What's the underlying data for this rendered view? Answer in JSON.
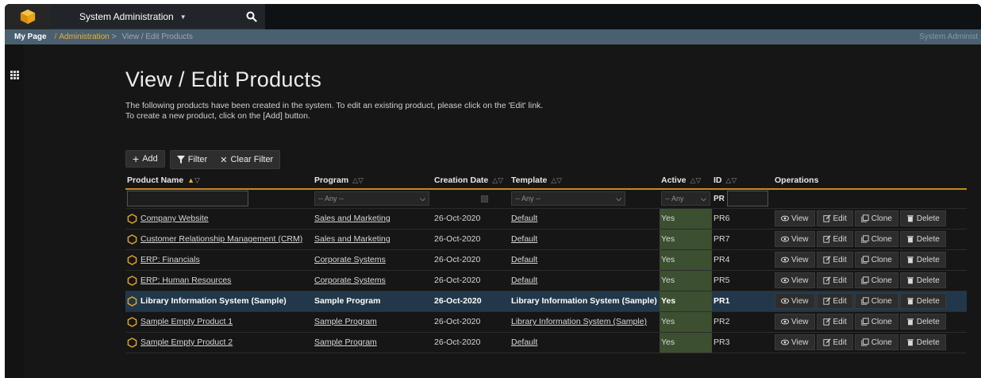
{
  "topbar": {
    "nav_title": "System Administration",
    "colors": {
      "logo": "#e8a317",
      "bar": "#212529"
    }
  },
  "breadcrumb": {
    "home": "My Page",
    "separator": "/",
    "admin": "Administration",
    "arrow": ">",
    "current": "View / Edit Products",
    "right_text": "System Administ"
  },
  "page": {
    "title": "View / Edit Products",
    "intro_line1": "The following products have been created in the system. To edit an existing product, please click on the 'Edit' link.",
    "intro_line2": "To create a new product, click on the [Add] button."
  },
  "toolbar": {
    "add_label": "Add",
    "filter_label": "Filter",
    "clear_filter_label": "Clear Filter"
  },
  "table": {
    "columns": {
      "name": "Product Name",
      "program": "Program",
      "date": "Creation Date",
      "template": "Template",
      "active": "Active",
      "id": "ID",
      "operations": "Operations"
    },
    "filters": {
      "program": "-- Any --",
      "template": "-- Any --",
      "active": "-- Any",
      "id_prefix": "PR"
    },
    "ops": {
      "view": "View",
      "edit": "Edit",
      "clone": "Clone",
      "delete": "Delete"
    },
    "rows": [
      {
        "name": "Company Website",
        "program": "Sales and Marketing",
        "date": "26-Oct-2020",
        "template": "Default",
        "active": "Yes",
        "id": "PR6"
      },
      {
        "name": "Customer Relationship Management (CRM)",
        "program": "Sales and Marketing",
        "date": "26-Oct-2020",
        "template": "Default",
        "active": "Yes",
        "id": "PR7"
      },
      {
        "name": "ERP: Financials",
        "program": "Corporate Systems",
        "date": "26-Oct-2020",
        "template": "Default",
        "active": "Yes",
        "id": "PR4"
      },
      {
        "name": "ERP: Human Resources",
        "program": "Corporate Systems",
        "date": "26-Oct-2020",
        "template": "Default",
        "active": "Yes",
        "id": "PR5"
      },
      {
        "name": "Library Information System (Sample)",
        "program": "Sample Program",
        "date": "26-Oct-2020",
        "template": "Library Information System (Sample)",
        "active": "Yes",
        "id": "PR1"
      },
      {
        "name": "Sample Empty Product 1",
        "program": "Sample Program",
        "date": "26-Oct-2020",
        "template": "Library Information System (Sample)",
        "active": "Yes",
        "id": "PR2"
      },
      {
        "name": "Sample Empty Product 2",
        "program": "Sample Program",
        "date": "26-Oct-2020",
        "template": "Default",
        "active": "Yes",
        "id": "PR3"
      }
    ]
  }
}
